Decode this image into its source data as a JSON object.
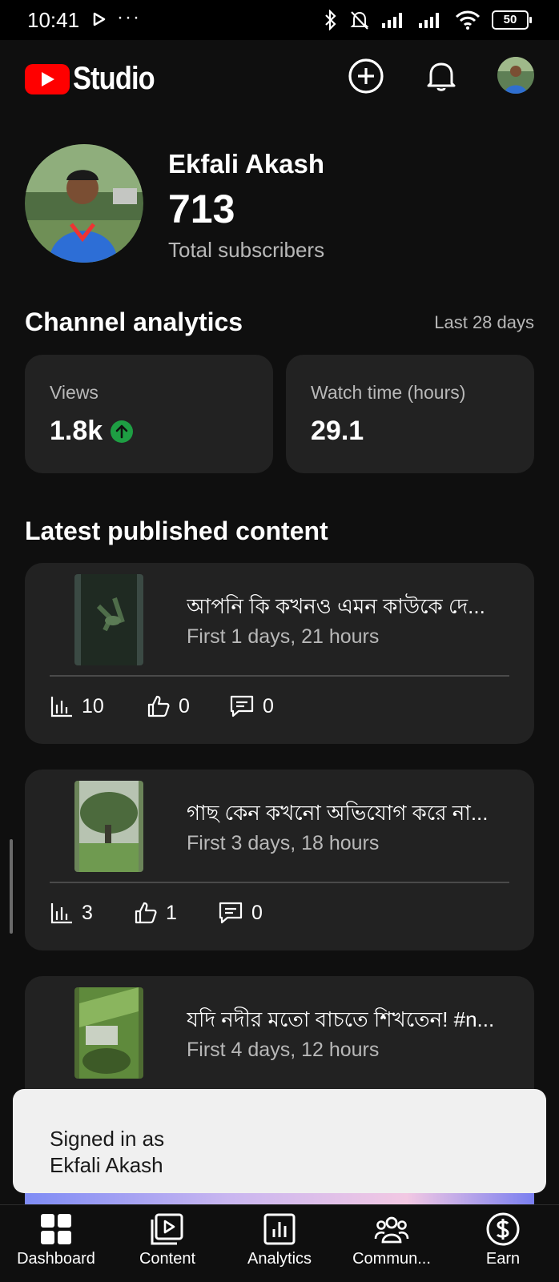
{
  "status_bar": {
    "time": "10:41",
    "more": "···",
    "battery": "50"
  },
  "header": {
    "logo_text": "Studio",
    "brand_color": "#ff0000"
  },
  "profile": {
    "name": "Ekfali Akash",
    "subscribers": "713",
    "subscribers_label": "Total subscribers"
  },
  "analytics": {
    "title": "Channel analytics",
    "range": "Last 28 days",
    "cards": [
      {
        "label": "Views",
        "value": "1.8k",
        "trend": "up"
      },
      {
        "label": "Watch time (hours)",
        "value": "29.1"
      }
    ]
  },
  "latest": {
    "title": "Latest published content",
    "items": [
      {
        "title": "আপনি কি কখনও এমন কাউকে দে...",
        "subtitle": "First 1 days, 21 hours",
        "views": "10",
        "likes": "0",
        "comments": "0"
      },
      {
        "title": "গাছ কেন কখনো অভিযোগ করে না...",
        "subtitle": "First 3 days, 18 hours",
        "views": "3",
        "likes": "1",
        "comments": "0"
      },
      {
        "title": "যদি নদীর মতো বাচতে শিখতেন! #n...",
        "subtitle": "First 4 days, 12 hours"
      }
    ]
  },
  "toast": {
    "line1": "Signed in as",
    "line2": "Ekfali Akash"
  },
  "nav": {
    "items": [
      {
        "label": "Dashboard",
        "icon": "dashboard-icon"
      },
      {
        "label": "Content",
        "icon": "content-icon"
      },
      {
        "label": "Analytics",
        "icon": "analytics-icon"
      },
      {
        "label": "Commun...",
        "icon": "community-icon"
      },
      {
        "label": "Earn",
        "icon": "dollar-icon"
      }
    ]
  }
}
